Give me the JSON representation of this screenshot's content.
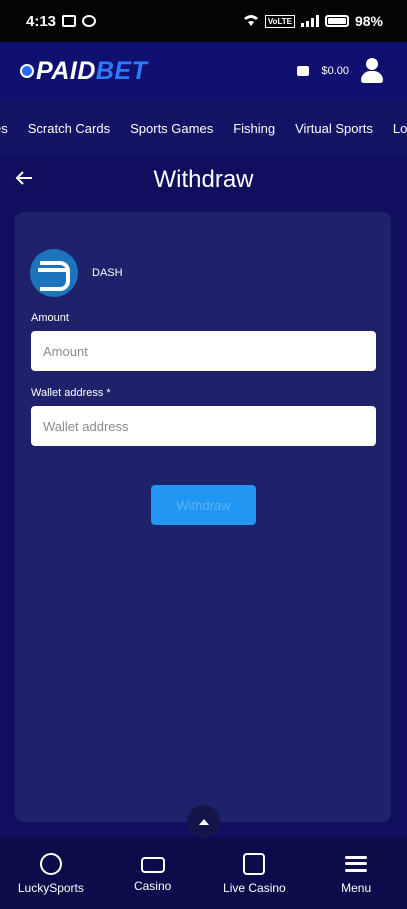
{
  "status_bar": {
    "time": "4:13",
    "volte": "VoLTE",
    "battery": "98%"
  },
  "header": {
    "logo_part1": "PAID",
    "logo_part2": "BET",
    "balance": "$0.00"
  },
  "nav": {
    "items": [
      {
        "label": "es"
      },
      {
        "label": "Scratch Cards"
      },
      {
        "label": "Sports Games"
      },
      {
        "label": "Fishing"
      },
      {
        "label": "Virtual Sports"
      },
      {
        "label": "Lotto"
      }
    ]
  },
  "page": {
    "title": "Withdraw"
  },
  "form": {
    "coin_name": "DASH",
    "amount_label": "Amount",
    "amount_placeholder": "Amount",
    "wallet_label": "Wallet address *",
    "wallet_placeholder": "Wallet address",
    "submit_label": "Withdraw"
  },
  "bottom_nav": {
    "items": [
      {
        "label": "LuckySports",
        "icon": "stopwatch-icon"
      },
      {
        "label": "Casino",
        "icon": "slot-machine-icon"
      },
      {
        "label": "Live Casino",
        "icon": "live-casino-icon"
      },
      {
        "label": "Menu",
        "icon": "menu-icon"
      }
    ]
  },
  "colors": {
    "background": "#0f0f5e",
    "header": "#101070",
    "card": "#1e226a",
    "accent": "#2196f3",
    "logo_blue": "#2a7bff",
    "dash_blue": "#1c75bc"
  }
}
